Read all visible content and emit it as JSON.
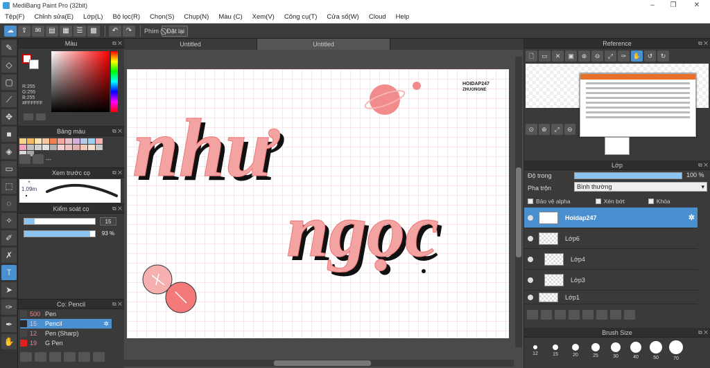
{
  "window": {
    "title": "MediBang Paint Pro (32bit)"
  },
  "menu": [
    "Tệp(F)",
    "Chỉnh sửa(E)",
    "Lớp(L)",
    "Bộ lọc(R)",
    "Chọn(S)",
    "Chụp(N)",
    "Màu (C)",
    "Xem(V)",
    "Công cụ(T)",
    "Cửa sổ(W)",
    "Cloud",
    "Help"
  ],
  "toolbar": {
    "key_label": "Phím",
    "reset_label": "Đặt lại"
  },
  "color_panel": {
    "title": "Màu",
    "rgb_text": "R:255\nG:255\nB:255\n#FFFFFF",
    "main_color": "#ffffff",
    "accent": "#4a90d0"
  },
  "palette_panel": {
    "title": "Bảng màu",
    "palette_name": "---"
  },
  "brush_preview": {
    "title": "Xem trước cọ",
    "size_label": "* 1.09m"
  },
  "brush_control": {
    "title": "Kiểm soát cọ",
    "size_value": "15",
    "size_fraction": 0.15,
    "opacity_value": "93 %",
    "opacity_fraction": 0.93
  },
  "brush_list": {
    "title": "Cọ: Pencil",
    "items": [
      {
        "num": "500",
        "name": "Pen",
        "color": "#444444"
      },
      {
        "num": "15",
        "name": "Pencil",
        "color": "#2a2a2a"
      },
      {
        "num": "12",
        "name": "Pen (Sharp)",
        "color": "#444444"
      },
      {
        "num": "19",
        "name": "G Pen",
        "color": "#e02020"
      }
    ]
  },
  "tabs": [
    "Untitled",
    "Untitled"
  ],
  "canvas": {
    "watermark_line1": "HOIDAP247",
    "watermark_line2": "ZHUONGNE",
    "word1": "như",
    "word2": "ngọc"
  },
  "reference": {
    "title": "Reference"
  },
  "layer_panel": {
    "title": "Lớp",
    "opacity_label": "Độ trong",
    "opacity_value": "100 %",
    "blend_label": "Pha trộn",
    "blend_value": "Bình thường",
    "protect_alpha": "Bảo vệ alpha",
    "clipping": "Xén bớt",
    "lock": "Khóa",
    "layers": [
      "Hoidap247",
      "Lớp6",
      "Lớp4",
      "Lớp3",
      "Lớp1"
    ]
  },
  "brush_size": {
    "title": "Brush Size",
    "sizes": [
      "12",
      "15",
      "20",
      "25",
      "30",
      "40",
      "50",
      "70"
    ]
  }
}
